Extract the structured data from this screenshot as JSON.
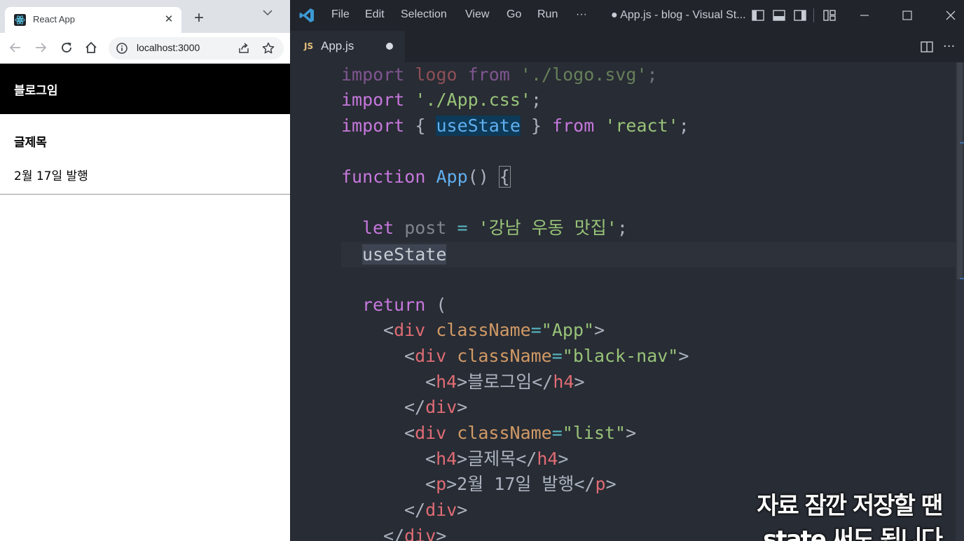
{
  "browser": {
    "tab_title": "React App",
    "url": "localhost:3000",
    "icons": {
      "favicon": "react-icon",
      "close": "close-icon",
      "new_tab": "plus-icon",
      "tab_menu": "chevron-down-icon",
      "back": "arrow-left-icon",
      "forward": "arrow-right-icon",
      "reload": "reload-icon",
      "home": "home-icon",
      "info": "info-icon",
      "share": "share-icon",
      "bookmark": "star-icon"
    },
    "page": {
      "nav_title": "블로그임",
      "post_title": "글제목",
      "post_date": "2월 17일 발행"
    }
  },
  "vscode": {
    "menu": [
      "File",
      "Edit",
      "Selection",
      "View",
      "Go",
      "Run",
      "···"
    ],
    "window_title": "● App.js - blog - Visual St...",
    "tab": {
      "lang_badge": "JS",
      "name": "App.js"
    },
    "more": "···",
    "code": {
      "l1": {
        "a": "import",
        "b": " logo ",
        "c": "from",
        "d": " ",
        "e": "'./logo.svg'",
        "f": ";"
      },
      "l2": {
        "a": "import",
        "b": " ",
        "c": "'./App.css'",
        "d": ";"
      },
      "l3": {
        "a": "import",
        "b": " { ",
        "c": "useState",
        "d": " } ",
        "e": "from",
        "f": " ",
        "g": "'react'",
        "h": ";"
      },
      "l5": {
        "a": "function",
        "b": " ",
        "c": "App",
        "d": "() ",
        "e": "{"
      },
      "l7": {
        "a": "let",
        "b": " post ",
        "c": "=",
        "d": " ",
        "e": "'강남 우동 맛집'",
        "f": ";"
      },
      "l8": {
        "a": "useState"
      },
      "l10": {
        "a": "return",
        "b": " ("
      },
      "l11": {
        "a": "<",
        "b": "div",
        "c": " className",
        "d": "=",
        "e": "\"App\"",
        "f": ">"
      },
      "l12": {
        "a": "<",
        "b": "div",
        "c": " className",
        "d": "=",
        "e": "\"black-nav\"",
        "f": ">"
      },
      "l13": {
        "a": "<",
        "b": "h4",
        "c": ">블로그임</",
        "d": "h4",
        "e": ">"
      },
      "l14": {
        "a": "</",
        "b": "div",
        "c": ">"
      },
      "l15": {
        "a": "<",
        "b": "div",
        "c": " className",
        "d": "=",
        "e": "\"list\"",
        "f": ">"
      },
      "l16": {
        "a": "<",
        "b": "h4",
        "c": ">글제목</",
        "d": "h4",
        "e": ">"
      },
      "l17": {
        "a": "<",
        "b": "p",
        "c": ">2월 17일 발행</",
        "d": "p",
        "e": ">"
      },
      "l18": {
        "a": "</",
        "b": "div",
        "c": ">"
      },
      "l19": {
        "a": "</",
        "b": "div",
        "c": ">"
      }
    }
  },
  "caption": {
    "line1": "자료 잠깐 저장할 땐",
    "line2": "state 써도 됩니다"
  },
  "colors": {
    "keyword": "#c678dd",
    "string": "#98c379",
    "function": "#61afef",
    "tag": "#e06c75",
    "attribute": "#d19a66"
  }
}
